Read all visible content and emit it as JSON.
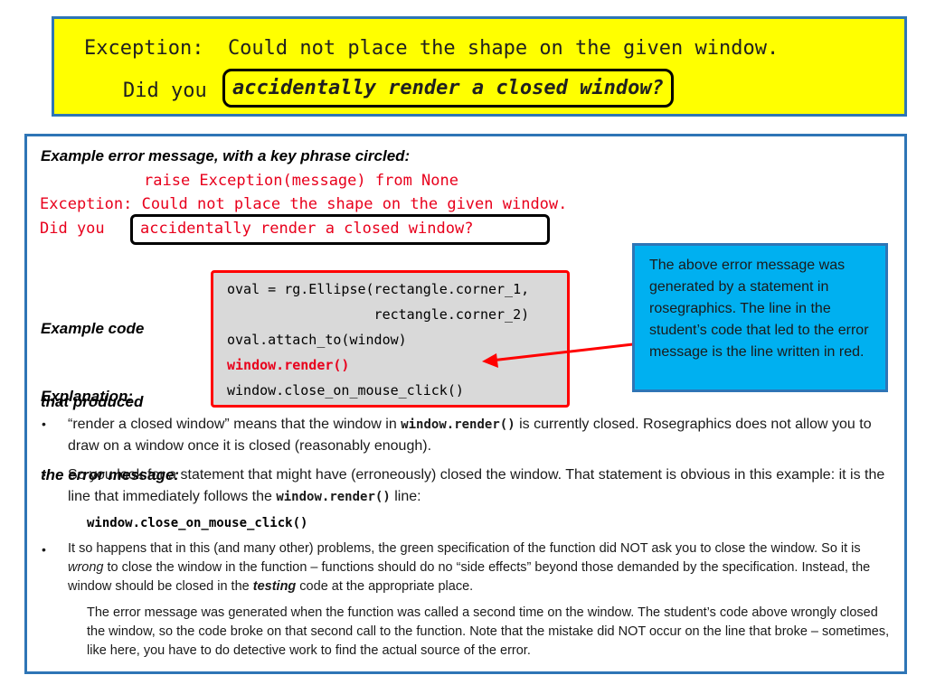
{
  "banner": {
    "line1": "Exception:  Could not place the shape on the given window.",
    "line2_prefix": "Did you",
    "line2_circled": "accidentally render a closed window?"
  },
  "example_error": {
    "heading": "Example error message, with a key phrase circled:",
    "line1": "raise Exception(message) from None",
    "line2": "Exception: Could not place the shape on the given window.",
    "line3_prefix": "Did you",
    "line3_circled": "accidentally render a closed window?"
  },
  "example_code": {
    "heading_lines": [
      "Example code",
      "that produced",
      "the error message:"
    ],
    "lines": [
      "oval = rg.Ellipse(rectangle.corner_1,",
      "                  rectangle.corner_2)",
      "oval.attach_to(window)",
      "window.render()",
      "window.close_on_mouse_click()"
    ],
    "highlighted_line_index": 3
  },
  "note": {
    "text": "The above error message was generated by a statement in rosegraphics.  The line in the student’s code that led to the error message is the line written in red."
  },
  "explanation": {
    "heading": "Explanation:",
    "bullets": [
      {
        "marker": "•",
        "parts": [
          "“render a closed window” means that the window in ",
          "window.render()",
          " is currently closed.  Rosegraphics does not allow you to draw on a window once it is closed (reasonably enough)."
        ]
      },
      {
        "marker": "•",
        "parts": [
          "So you look for a statement that might have (erroneously) closed the window.  That statement is obvious in this example:  it is the line that immediately follows the ",
          "window.render()",
          " line:"
        ],
        "code_line": "window.close_on_mouse_click()"
      },
      {
        "marker": "•",
        "parts": [
          "It so happens that in this (and many other) problems, the green specification of the function did NOT ask you to close the window.  So it is ",
          "wrong",
          " to close the window in the function – functions should do no “side effects” beyond those demanded by the specification.  Instead, the window should be closed in the ",
          "testing",
          " code at the appropriate place."
        ]
      }
    ],
    "closing": "The error message was generated when the function was called a second time on the window.  The student’s code above wrongly closed the window, so the code broke on that second call to the function.  Note that the mistake did NOT occur on the line that broke – sometimes, like here, you have to do detective work to find the actual source of the error."
  }
}
